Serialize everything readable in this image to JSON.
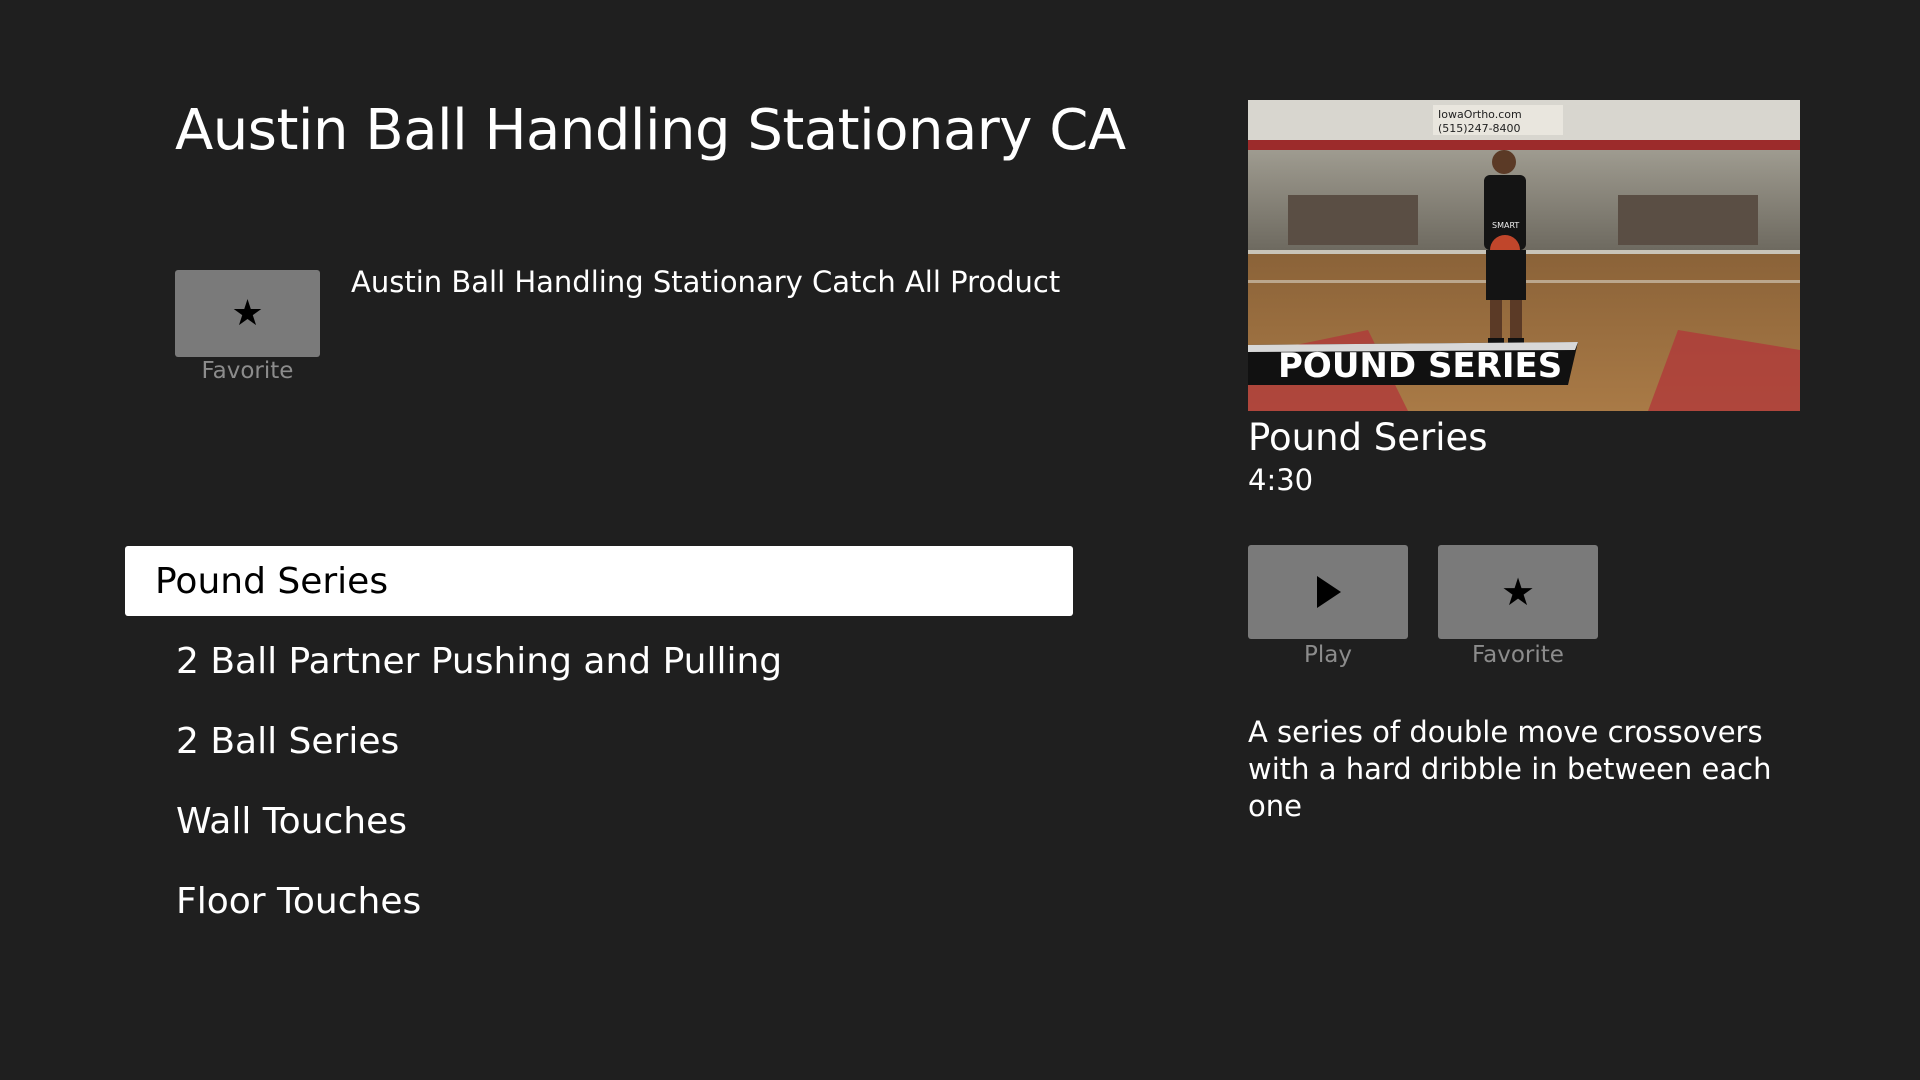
{
  "header": {
    "title": "Austin Ball Handling Stationary CA"
  },
  "product": {
    "favorite_icon": "★",
    "favorite_label": "Favorite",
    "description": "Austin Ball Handling Stationary Catch All Product"
  },
  "episodes": [
    {
      "label": "Pound Series",
      "selected": true
    },
    {
      "label": "2 Ball Partner Pushing and Pulling",
      "selected": false
    },
    {
      "label": "2 Ball Series",
      "selected": false
    },
    {
      "label": "Wall Touches",
      "selected": false
    },
    {
      "label": "Floor Touches",
      "selected": false
    }
  ],
  "detail": {
    "thumbnail": {
      "banner_text": "POUND SERIES",
      "sign_line1": "IowaOrtho.com",
      "sign_line2": "(515)247-8400",
      "shirt_text": "SMART"
    },
    "title": "Pound Series",
    "duration": "4:30",
    "play_icon": "play-icon",
    "play_label": "Play",
    "favorite_icon": "★",
    "favorite_label": "Favorite",
    "description": "A series of double move crossovers with a hard dribble in between each one"
  },
  "colors": {
    "background": "#1f1f1f",
    "tile": "#7a7a7a",
    "caption": "#8c8c8c",
    "selected_bg": "#ffffff"
  }
}
